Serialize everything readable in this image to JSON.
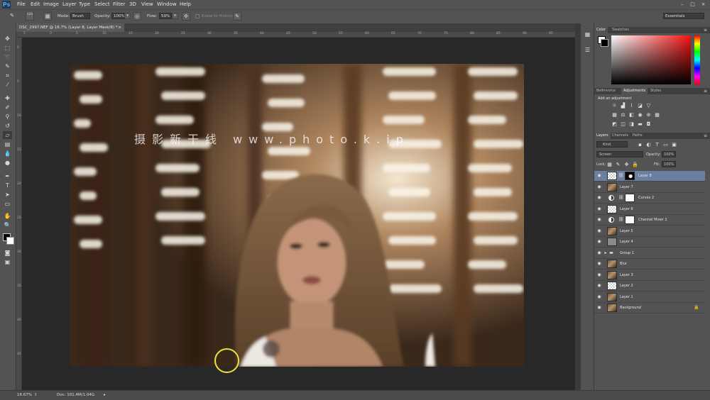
{
  "app": {
    "logo": "Ps"
  },
  "menu": [
    "File",
    "Edit",
    "Image",
    "Layer",
    "Type",
    "Select",
    "Filter",
    "3D",
    "View",
    "Window",
    "Help"
  ],
  "window_controls": [
    "–",
    "□",
    "×"
  ],
  "options": {
    "mode_label": "Mode:",
    "mode_value": "Brush",
    "opacity_label": "Opacity:",
    "opacity_value": "100%",
    "flow_label": "Flow:",
    "flow_value": "59%",
    "erase_history_label": "Erase to History",
    "brush_size": "125",
    "workspace": "Essentials"
  },
  "document": {
    "tab_title": "DSC_2997.NEF @ 16.7% (Layer 8, Layer Mask/8) *",
    "ruler_ticks": [
      "5",
      "0",
      "5",
      "10",
      "15",
      "20",
      "25",
      "30",
      "35",
      "40",
      "45",
      "50",
      "55",
      "60",
      "65",
      "70",
      "75",
      "80",
      "85",
      "90",
      "95"
    ],
    "ruler_left_ticks": [
      "0",
      "5",
      "10",
      "15",
      "20",
      "25",
      "30",
      "35",
      "40",
      "45"
    ],
    "watermark": "摄影新干线 www.photo.k.ip",
    "zoom": "16.67%",
    "doc_size": "Doc: 101.4M/1.04G"
  },
  "color_panel": {
    "tabs": [
      "Color",
      "Swatches"
    ]
  },
  "adjustments_panel": {
    "tabs": [
      "Bellinvoice",
      "Adjustments",
      "Styles"
    ],
    "hint": "Add an adjustment"
  },
  "layers_panel": {
    "tabs": [
      "Layers",
      "Channels",
      "Paths"
    ],
    "kind": "Kind",
    "blend_mode": "Screen",
    "opacity_label": "Opacity:",
    "opacity_value": "100%",
    "lock_label": "Lock:",
    "fill_label": "Fill:",
    "fill_value": "100%",
    "layers": [
      {
        "name": "Layer 8",
        "thumb": "trans",
        "mask": "dark",
        "selected": true
      },
      {
        "name": "Layer 7",
        "thumb": "photo"
      },
      {
        "name": "Curves 2",
        "thumb": "adj",
        "mask": "white"
      },
      {
        "name": "Layer 6",
        "thumb": "trans"
      },
      {
        "name": "Channel Mixer 1",
        "thumb": "adj",
        "mask": "white"
      },
      {
        "name": "Layer 5",
        "thumb": "photo"
      },
      {
        "name": "Layer 4",
        "thumb": "gray"
      },
      {
        "name": "Group 1",
        "thumb": "folder"
      },
      {
        "name": "Blur",
        "thumb": "photo"
      },
      {
        "name": "Layer 3",
        "thumb": "photo"
      },
      {
        "name": "Layer 2",
        "thumb": "trans"
      },
      {
        "name": "Layer 1",
        "thumb": "photo"
      },
      {
        "name": "Background",
        "thumb": "photo",
        "italic": true,
        "locked": true
      }
    ]
  },
  "colors": {
    "accent": "#6b7fa0",
    "brush_circle": "#f1e232"
  }
}
